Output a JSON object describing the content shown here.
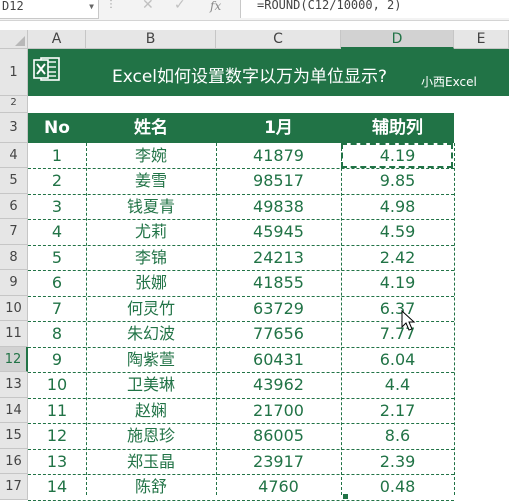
{
  "formula_bar": {
    "name_box": "D12",
    "formula": "=ROUND(C12/10000, 2)"
  },
  "columns": [
    "A",
    "B",
    "C",
    "D",
    "E"
  ],
  "rows": [
    "1",
    "2",
    "3",
    "4",
    "5",
    "6",
    "7",
    "8",
    "9",
    "10",
    "11",
    "12",
    "13",
    "14",
    "15",
    "16",
    "17"
  ],
  "banner": {
    "title": "Excel如何设置数字以万为单位显示?",
    "brand": "小西Excel"
  },
  "table": {
    "headers": [
      "No",
      "姓名",
      "1月",
      "辅助列"
    ],
    "rows": [
      [
        "1",
        "李婉",
        "41879",
        "4.19"
      ],
      [
        "2",
        "姜雪",
        "98517",
        "9.85"
      ],
      [
        "3",
        "钱夏青",
        "49838",
        "4.98"
      ],
      [
        "4",
        "尤莉",
        "45945",
        "4.59"
      ],
      [
        "5",
        "李锦",
        "24213",
        "2.42"
      ],
      [
        "6",
        "张娜",
        "41855",
        "4.19"
      ],
      [
        "7",
        "何灵竹",
        "63729",
        "6.37"
      ],
      [
        "8",
        "朱幻波",
        "77656",
        "7.77"
      ],
      [
        "9",
        "陶紫萱",
        "60431",
        "6.04"
      ],
      [
        "10",
        "卫美琳",
        "43962",
        "4.4"
      ],
      [
        "11",
        "赵娴",
        "21700",
        "2.17"
      ],
      [
        "12",
        "施恩珍",
        "86005",
        "8.6"
      ],
      [
        "13",
        "郑玉晶",
        "23917",
        "2.39"
      ],
      [
        "14",
        "陈舒",
        "4760",
        "0.48"
      ]
    ]
  },
  "colors": {
    "accent": "#217346",
    "header_bg": "#e6e6e6"
  }
}
